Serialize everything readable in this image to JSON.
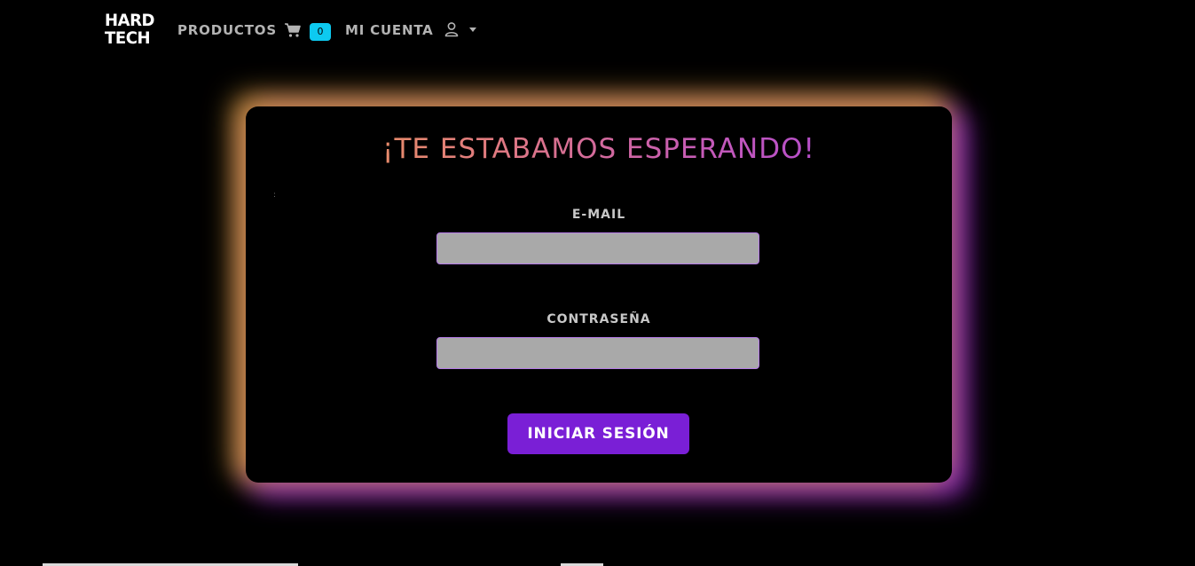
{
  "brand": {
    "logo_line1": "HARD",
    "logo_line2": "TECH"
  },
  "nav": {
    "products_label": "PRODUCTOS",
    "cart_count": "0",
    "account_label": "MI CUENTA"
  },
  "login": {
    "title": "¡TE ESTABAMOS ESPERANDO!",
    "stray_mark": ":",
    "email_label": "E-MAIL",
    "email_value": "",
    "password_label": "CONTRASEÑA",
    "password_value": "",
    "submit_label": "INICIAR SESIÓN"
  },
  "colors": {
    "background": "#000000",
    "cart_badge": "#0dcaf0",
    "submit_button": "#7a1fd6",
    "input_fill": "#a9a9a9",
    "input_border": "#b57be8",
    "glow_warm": "#e6aa3c",
    "glow_purple": "#9628d2"
  }
}
